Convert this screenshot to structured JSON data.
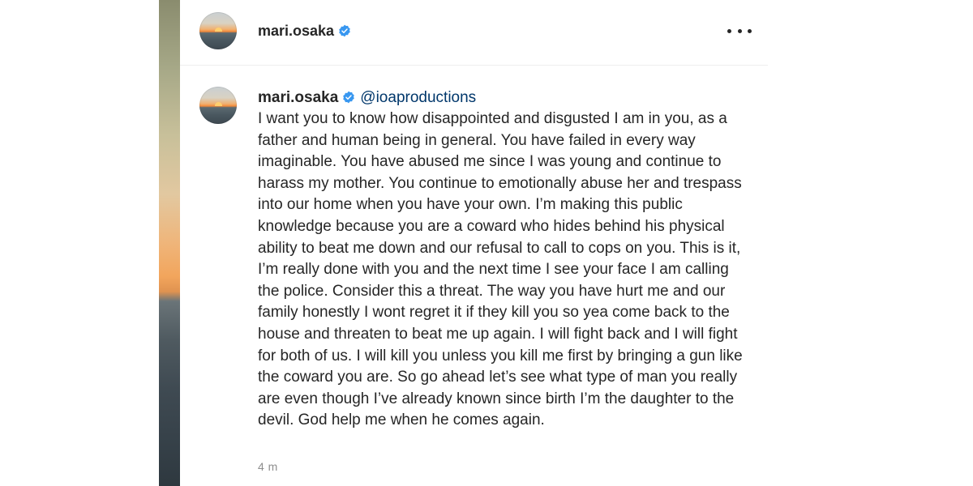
{
  "post": {
    "author": "mari.osaka",
    "more_icon": "more-horizontal-icon",
    "verified_icon": "verified-badge-icon",
    "verified_color": "#3897f0"
  },
  "comment": {
    "author": "mari.osaka",
    "mention": "@ioaproductions",
    "text": "I want you to know how disappointed and disgusted I am in you, as a father and human being in general. You have failed in every way imaginable. You have abused me since I was young and continue to harass my mother. You continue to emotionally abuse her and trespass into our home when you have your own. I’m making this public knowledge because you are a coward who hides behind his physical ability to beat me down and our refusal to call to cops on you. This is it, I’m really done with you and the next time I see your face I am calling the police. Consider this a threat. The way you have hurt me and our family honestly I wont regret it if they kill you so yea come back to the house and threaten to beat me up again. I will fight back and I will fight for both of us. I will kill you unless you kill me first by bringing a gun like the coward you are. So go ahead let’s see what type of man you really are even though I’ve already known since birth I’m the daughter to the devil. God help me when he comes again.",
    "timestamp": "4 m"
  },
  "colors": {
    "text": "#262626",
    "mention": "#00376b",
    "muted": "#8e8e8e",
    "divider": "#efefef"
  }
}
